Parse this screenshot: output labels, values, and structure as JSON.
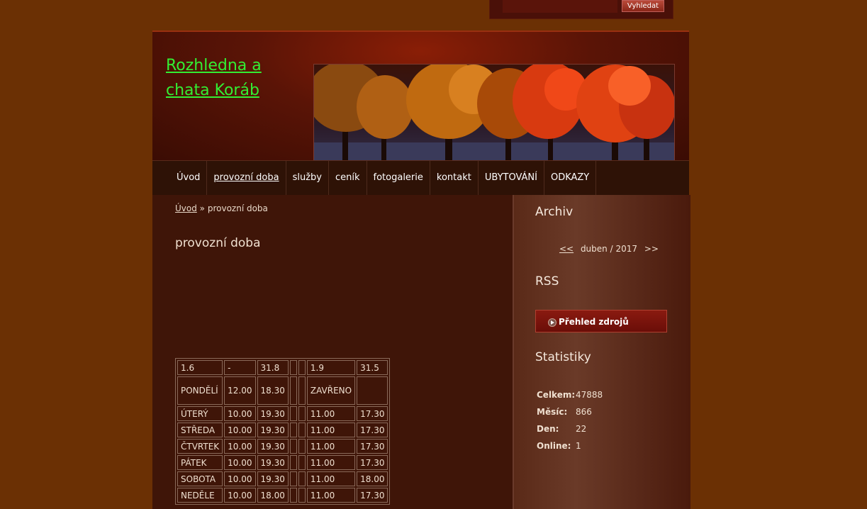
{
  "search": {
    "value": "",
    "button_label": "Vyhledat"
  },
  "site": {
    "title": "Rozhledna a chata Koráb"
  },
  "nav": {
    "items": [
      {
        "label": "Úvod"
      },
      {
        "label": "provozní doba"
      },
      {
        "label": "služby"
      },
      {
        "label": "ceník"
      },
      {
        "label": "fotogalerie"
      },
      {
        "label": "kontakt"
      },
      {
        "label": "UBYTOVÁNÍ"
      },
      {
        "label": "ODKAZY"
      }
    ],
    "active_index": 1
  },
  "breadcrumb": {
    "home": "Úvod",
    "separator": "»",
    "current": "provozní doba"
  },
  "page": {
    "title": "provozní doba"
  },
  "hours_table": {
    "rows": [
      [
        "1.6",
        "-",
        "31.8",
        "",
        "",
        "1.9",
        "31.5"
      ],
      [
        "PONDĚLÍ",
        "12.00",
        "18.30",
        "",
        "",
        "ZAVŘENO",
        ""
      ],
      [
        "ÚTERÝ",
        "10.00",
        "19.30",
        "",
        "",
        "11.00",
        "17.30"
      ],
      [
        "STŘEDA",
        "10.00",
        "19.30",
        "",
        "",
        "11.00",
        "17.30"
      ],
      [
        "ČTVRTEK",
        "10.00",
        "19.30",
        "",
        "",
        "11.00",
        "17.30"
      ],
      [
        "PÁTEK",
        "10.00",
        "19.30",
        "",
        "",
        "11.00",
        "17.30"
      ],
      [
        "SOBOTA",
        "10.00",
        "19.30",
        "",
        "",
        "11.00",
        "18.00"
      ],
      [
        "NEDĚLE",
        "10.00",
        "18.00",
        "",
        "",
        "11.00",
        "17.30"
      ]
    ]
  },
  "sidebar": {
    "archive": {
      "heading": "Archiv",
      "prev": "<<",
      "month": "duben / 2017",
      "next": ">>"
    },
    "rss": {
      "heading": "RSS",
      "button_label": "Přehled zdrojů"
    },
    "stats": {
      "heading": "Statistiky",
      "rows": [
        {
          "label": "Celkem:",
          "value": "47888"
        },
        {
          "label": "Měsíc:",
          "value": "866"
        },
        {
          "label": "Den:",
          "value": "22"
        },
        {
          "label": "Online:",
          "value": "1"
        }
      ]
    }
  },
  "colors": {
    "background": "#6b3004",
    "title_link": "#33ee33",
    "accent": "#8a1a10"
  }
}
